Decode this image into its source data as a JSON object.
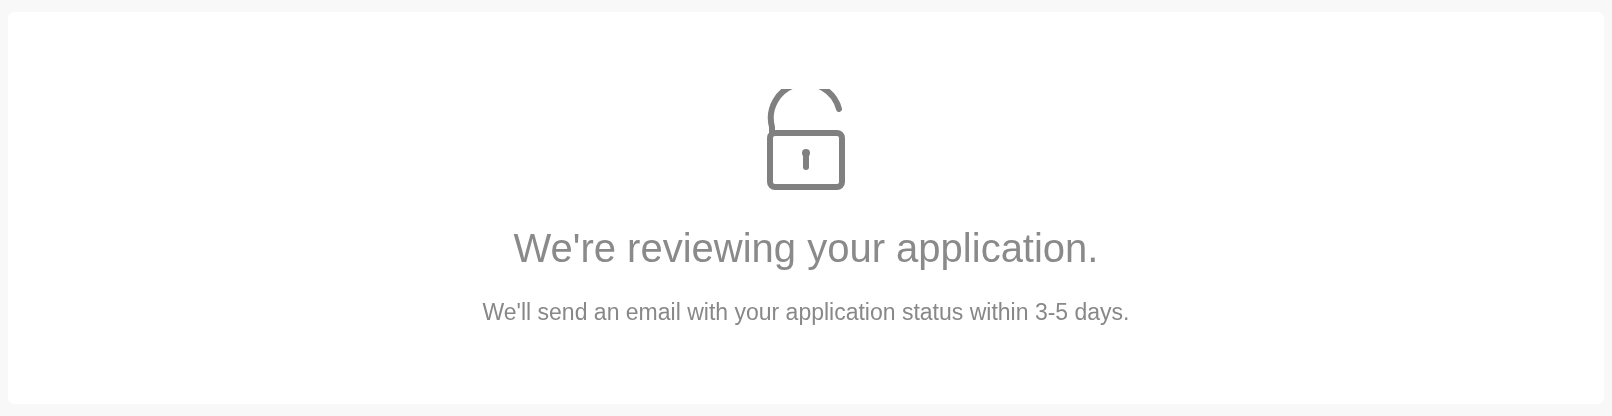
{
  "status_card": {
    "title": "We're reviewing your application.",
    "message": "We'll send an email with your application status within 3-5 days."
  }
}
